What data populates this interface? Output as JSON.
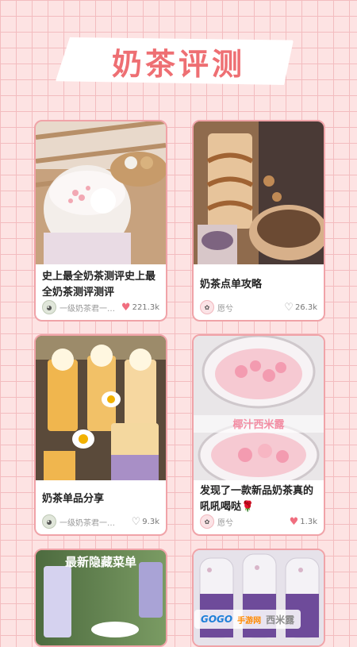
{
  "page": {
    "title": "奶茶评测"
  },
  "cards": [
    {
      "title": "史上最全奶茶测评史上最全奶茶测评测评",
      "author": "一级奶茶君一…",
      "likes": "221.3k",
      "heart": "filled",
      "avatar": "green"
    },
    {
      "title": "奶茶点单攻略",
      "author": "愿兮",
      "likes": "26.3k",
      "heart": "outline",
      "avatar": "rose"
    },
    {
      "title": "奶茶单品分享",
      "author": "一级奶茶君一…",
      "likes": "9.3k",
      "heart": "outline",
      "avatar": "green"
    },
    {
      "title": "发现了一款新品奶茶真的吼吼喝哒🌹",
      "author": "愿兮",
      "likes": "1.3k",
      "heart": "filled",
      "avatar": "rose"
    }
  ],
  "partial_cards": [
    {
      "overlay_text": "最新隐藏菜单"
    },
    {
      "overlay_text": ""
    }
  ],
  "image_overlays": {
    "card4": "椰汁西米露"
  },
  "watermark": {
    "logo": "GOGO",
    "site": "手游网",
    "text": "西米露"
  },
  "colors": {
    "accent": "#ee6f73",
    "border": "#f0a3a8",
    "grid": "#f3bcbf",
    "background": "#fde3e3"
  }
}
